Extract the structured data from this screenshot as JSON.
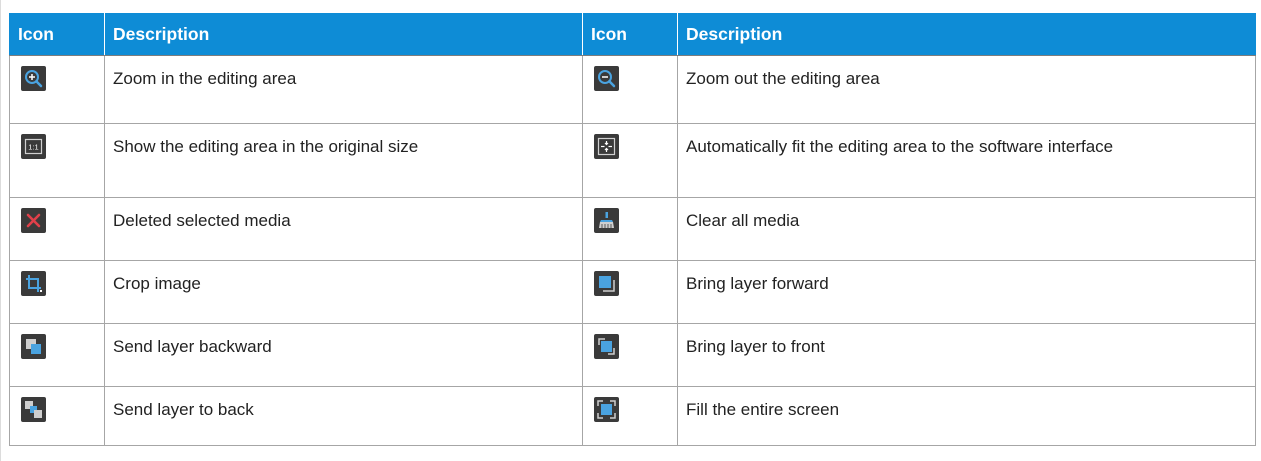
{
  "header": {
    "col1": "Icon",
    "col2": "Description",
    "col3": "Icon",
    "col4": "Description"
  },
  "rows": [
    {
      "left": {
        "icon": "zoom-in-icon",
        "desc": "Zoom in the editing area"
      },
      "right": {
        "icon": "zoom-out-icon",
        "desc": "Zoom out the editing area"
      }
    },
    {
      "left": {
        "icon": "original-size-icon",
        "desc": "Show the editing area in the original size"
      },
      "right": {
        "icon": "fit-to-window-icon",
        "desc": "Automatically fit the editing area to the software interface"
      }
    },
    {
      "left": {
        "icon": "delete-icon",
        "desc": "Deleted selected media"
      },
      "right": {
        "icon": "clear-all-icon",
        "desc": "Clear all media"
      }
    },
    {
      "left": {
        "icon": "crop-icon",
        "desc": "Crop image"
      },
      "right": {
        "icon": "bring-forward-icon",
        "desc": "Bring layer forward"
      }
    },
    {
      "left": {
        "icon": "send-backward-icon",
        "desc": "Send layer backward"
      },
      "right": {
        "icon": "bring-to-front-icon",
        "desc": "Bring layer to front"
      }
    },
    {
      "left": {
        "icon": "send-to-back-icon",
        "desc": "Send layer to back"
      },
      "right": {
        "icon": "fill-screen-icon",
        "desc": "Fill the entire screen"
      }
    }
  ],
  "icon_labels": {
    "original_size": "1:1"
  },
  "colors": {
    "header_bg": "#0e8cd6",
    "icon_bg": "#3a3a3a",
    "icon_accent": "#4aa3e0",
    "delete_red": "#e0404a"
  }
}
